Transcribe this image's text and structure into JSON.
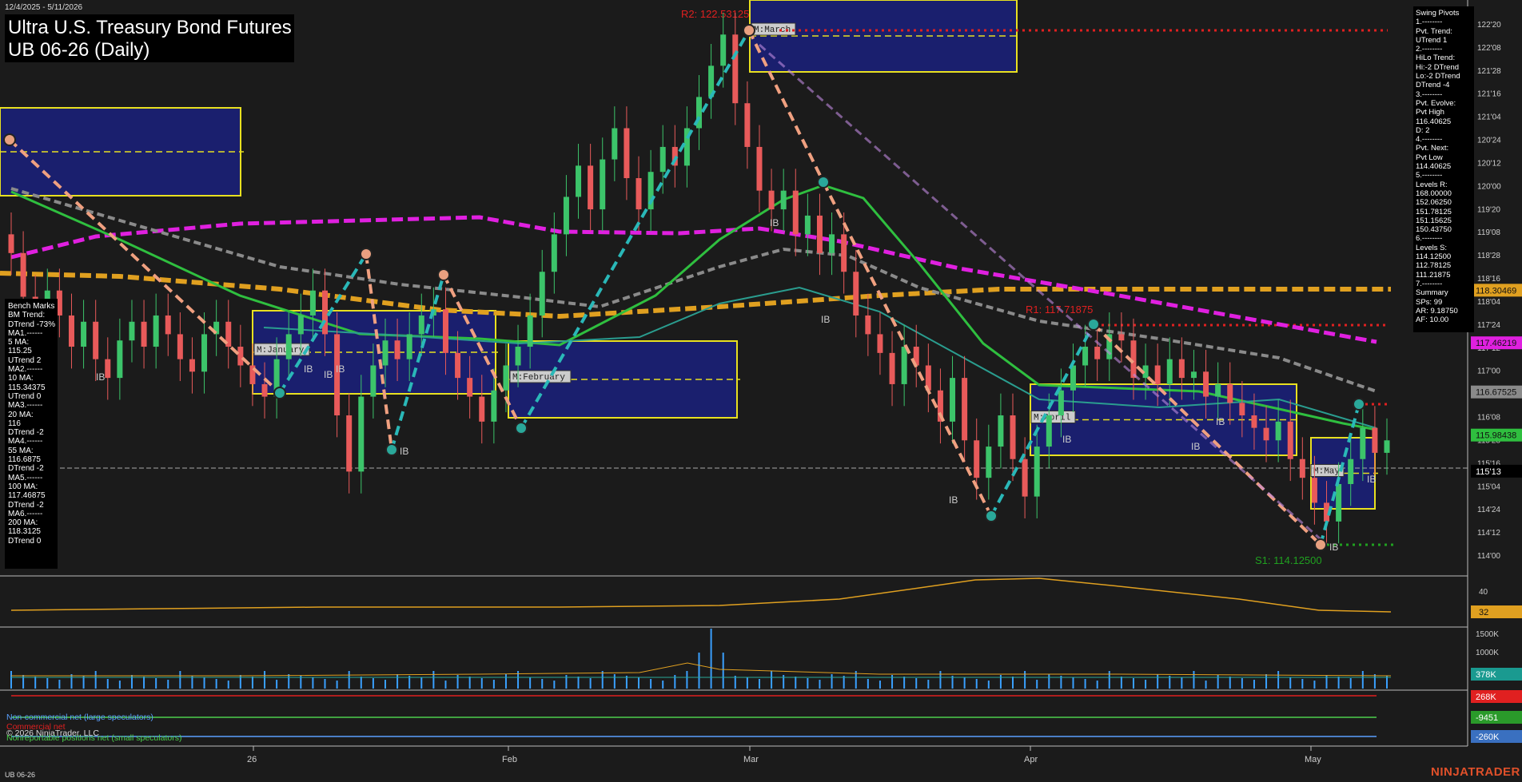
{
  "header": {
    "date_range": "12/4/2025 - 5/11/2026",
    "title_line1": "Ultra U.S. Treasury Bond Futures",
    "title_line2": "UB 06-26 (Daily)",
    "footer_symbol": "UB 06-26",
    "brand": "NINJATRADER"
  },
  "bench_marks": {
    "text": "Bench Marks\nBM Trend:\nDTrend -73%\nMA1.------\n5 MA:\n115.25\nUTrend 2\nMA2.------\n10 MA:\n115.34375\nUTrend 0\nMA3.------\n20 MA:\n116\nDTrend -2\nMA4.------\n55 MA:\n116.6875\nDTrend -2\nMA5.------\n100 MA:\n117.46875\nDTrend -2\nMA6.------\n200 MA:\n118.3125\nDTrend 0"
  },
  "swing_pivots": {
    "text": "Swing Pivots\n1.--------\nPvt. Trend:\nUTrend 1\n2.--------\nHiLo Trend:\nHi:-2 DTrend\nLo:-2 DTrend\nDTrend -4\n3.--------\nPvt. Evolve:\nPvt High\n116.40625\nD: 2\n4.--------\nPvt. Next:\nPvt Low\n114.40625\n5.--------\nLevels R:\n168.00000\n152.06250\n151.78125\n151.15625\n150.43750\n6.--------\nLevels S:\n114.12500\n112.78125\n111.21875\n7.--------\nSummary\nSPs: 99\nAR: 9.18750\nAF: 10.00"
  },
  "annotations": {
    "r2": "R2: 122.53125",
    "r1": "R1: 117.71875",
    "s1": "S1: 114.12500",
    "months": [
      "M:January",
      "M:February",
      "M:March",
      "M:April",
      "M:May"
    ],
    "ib": "IB"
  },
  "legend": {
    "noncommercial": "Non-commercial net (large speculators)",
    "commercial": "Commercial net",
    "copyright": "© 2026 NinjaTrader, LLC",
    "nonreportable": "Nonreportable positions net (small speculators)"
  },
  "colors": {
    "background": "#1b1b1b",
    "up_candle": "#3cc46a",
    "down_candle": "#e85a5a",
    "ma_green": "#2fbf3f",
    "ma_teal": "#2a9d8f",
    "ma_gray": "#8a8a8a",
    "ma_magenta": "#e020e0",
    "ma_orange": "#e0a020",
    "zigzag_teal": "#2ab8b8",
    "zigzag_salmon": "#f0a080",
    "zone_fill": "#1a1f6e",
    "zone_border": "#e8e020",
    "resistance": "#e02020",
    "support": "#20a020"
  },
  "chart_data": {
    "type": "candlestick",
    "x_ticks": [
      "26",
      "Feb",
      "Mar",
      "Apr",
      "May"
    ],
    "price_ticks": [
      "122'20",
      "122'08",
      "121'28",
      "121'16",
      "121'04",
      "120'24",
      "120'12",
      "120'00",
      "119'20",
      "119'08",
      "118'28",
      "118'16",
      "118'04",
      "117'24",
      "117'12",
      "117'00",
      "116'20",
      "116'08",
      "115'28",
      "115'16",
      "115'04",
      "114'24",
      "114'12",
      "114'00"
    ],
    "price_labels": [
      {
        "text": "118.30469",
        "value": 118.30469,
        "color": "#e0a020"
      },
      {
        "text": "117.46219",
        "value": 117.46219,
        "color": "#e020e0"
      },
      {
        "text": "116.67525",
        "value": 116.67525,
        "color": "#8a8a8a"
      },
      {
        "text": "115.98438",
        "value": 115.98438,
        "color": "#2fbf3f"
      },
      {
        "text": "115'13",
        "value": 115.40625,
        "color": "#000000"
      }
    ],
    "ylim": [
      113.85,
      122.85
    ],
    "closes": [
      118.9,
      118.2,
      117.6,
      118.3,
      117.9,
      117.4,
      117.8,
      117.2,
      116.9,
      117.5,
      117.8,
      117.4,
      117.9,
      117.6,
      117.2,
      117.0,
      117.6,
      117.8,
      117.4,
      117.1,
      116.8,
      116.6,
      117.2,
      117.6,
      117.9,
      118.3,
      117.6,
      116.3,
      115.4,
      116.6,
      117.1,
      117.5,
      117.2,
      117.6,
      117.9,
      118.0,
      117.3,
      116.9,
      116.6,
      116.2,
      116.7,
      117.1,
      117.4,
      117.9,
      118.6,
      119.2,
      119.8,
      120.3,
      119.6,
      120.4,
      120.9,
      120.1,
      119.6,
      120.2,
      120.6,
      120.3,
      120.9,
      121.4,
      121.9,
      122.4,
      121.3,
      120.6,
      119.9,
      119.6,
      119.9,
      119.2,
      119.5,
      118.9,
      119.2,
      118.6,
      117.9,
      117.6,
      117.3,
      116.8,
      117.4,
      117.1,
      116.7,
      116.2,
      116.9,
      115.9,
      115.3,
      115.8,
      116.3,
      115.6,
      115.0,
      115.8,
      116.3,
      116.7,
      117.1,
      117.4,
      117.2,
      117.6,
      117.5,
      116.9,
      117.1,
      116.8,
      117.2,
      116.9,
      117.0,
      116.6,
      116.8,
      116.5,
      116.3,
      116.1,
      115.9,
      116.2,
      115.6,
      115.3,
      114.9,
      114.6,
      115.2,
      115.6,
      116.1,
      115.7,
      115.9
    ],
    "ma_series": [
      {
        "label": "5 MA",
        "value": 115.25
      },
      {
        "label": "10 MA",
        "value": 115.34375
      },
      {
        "label": "20 MA",
        "value": 116
      },
      {
        "label": "55 MA",
        "value": 116.6875
      },
      {
        "label": "100 MA",
        "value": 117.46875
      },
      {
        "label": "200 MA",
        "value": 118.3125
      }
    ],
    "oscillator": {
      "ticks": [
        "40"
      ],
      "last": "32"
    },
    "volume": {
      "ticks": [
        "1500K",
        "1000K"
      ],
      "last": "378K"
    },
    "cot": {
      "labels": [
        "268K",
        "-9451",
        "-260K"
      ]
    }
  }
}
